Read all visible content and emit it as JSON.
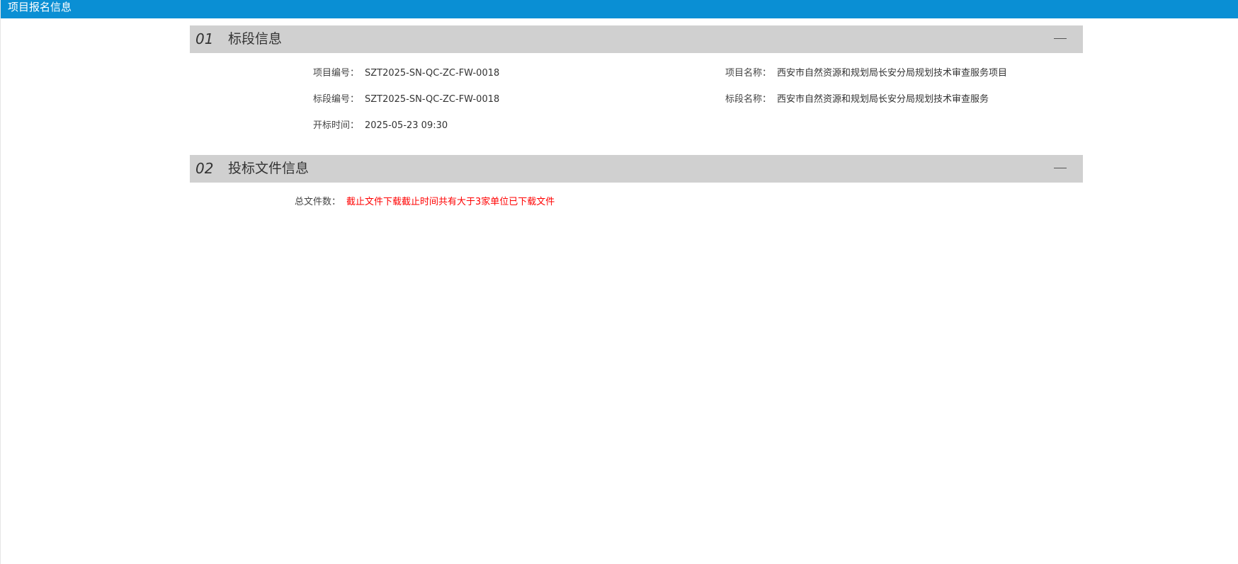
{
  "app": {
    "title": "项目报名信息"
  },
  "sections": [
    {
      "number": "01",
      "title": "标段信息",
      "fields": {
        "project_no_label": "项目编号：",
        "project_no_value": "SZT2025-SN-QC-ZC-FW-0018",
        "project_name_label": "项目名称：",
        "project_name_value": "西安市自然资源和规划局长安分局规划技术审查服务项目",
        "section_no_label": "标段编号：",
        "section_no_value": "SZT2025-SN-QC-ZC-FW-0018",
        "section_name_label": "标段名称：",
        "section_name_value": "西安市自然资源和规划局长安分局规划技术审查服务",
        "open_time_label": "开标时间：",
        "open_time_value": "2025-05-23 09:30"
      }
    },
    {
      "number": "02",
      "title": "投标文件信息",
      "fields": {
        "total_files_label": "总文件数：",
        "total_files_value": "截止文件下载截止时间共有大于3家单位已下载文件"
      }
    }
  ],
  "colors": {
    "topbar": "#0a8fd4",
    "section_header_bg": "#d0d0d0",
    "alert_text": "#ff0000"
  },
  "icons": {
    "collapse": "minus-icon"
  }
}
